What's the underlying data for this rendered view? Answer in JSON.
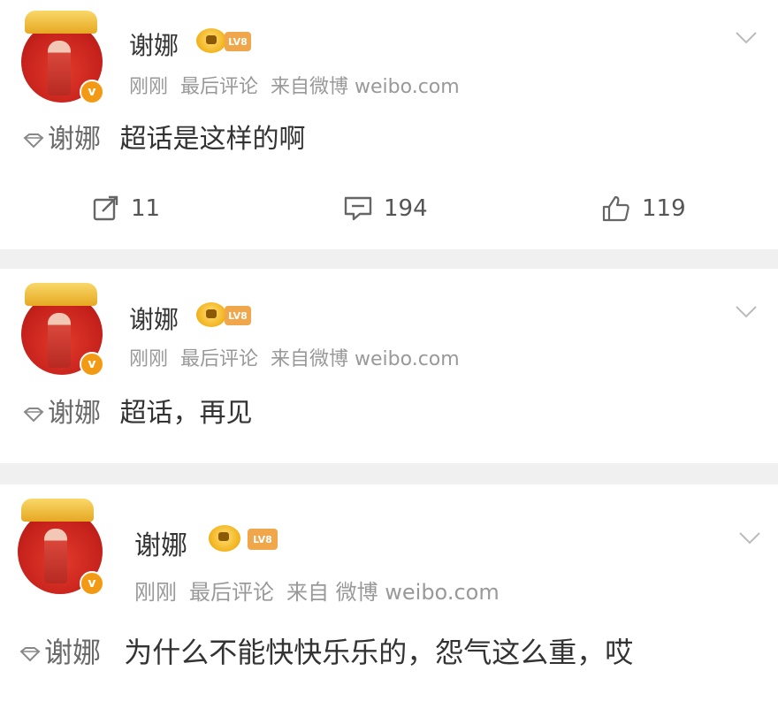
{
  "posts": [
    {
      "author": "谢娜",
      "level": "LV8",
      "verified_mark": "v",
      "meta": {
        "time": "刚刚",
        "sort": "最后评论",
        "source": "来自微博 weibo.com"
      },
      "topic": "谢娜",
      "text": "超话是这样的啊",
      "actions": {
        "repost": "11",
        "comment": "194",
        "like": "119"
      }
    },
    {
      "author": "谢娜",
      "level": "LV8",
      "verified_mark": "v",
      "meta": {
        "time": "刚刚",
        "sort": "最后评论",
        "source": "来自微博 weibo.com"
      },
      "topic": "谢娜",
      "text": "超话，再见"
    },
    {
      "author": "谢娜",
      "level": "LV8",
      "verified_mark": "v",
      "meta": {
        "time": "刚刚",
        "sort": "最后评论",
        "source": "来自 微博 weibo.com"
      },
      "topic": "谢娜",
      "text": "为什么不能快快乐乐的，怨气这么重，哎"
    }
  ],
  "colors": {
    "accent": "#f39a14",
    "separator": "#f0f0f0",
    "meta": "#999999"
  },
  "icons": [
    "chevron-down-icon",
    "topic-diamond-icon",
    "repost-icon",
    "comment-icon",
    "like-icon",
    "crown-icon",
    "verified-icon"
  ]
}
